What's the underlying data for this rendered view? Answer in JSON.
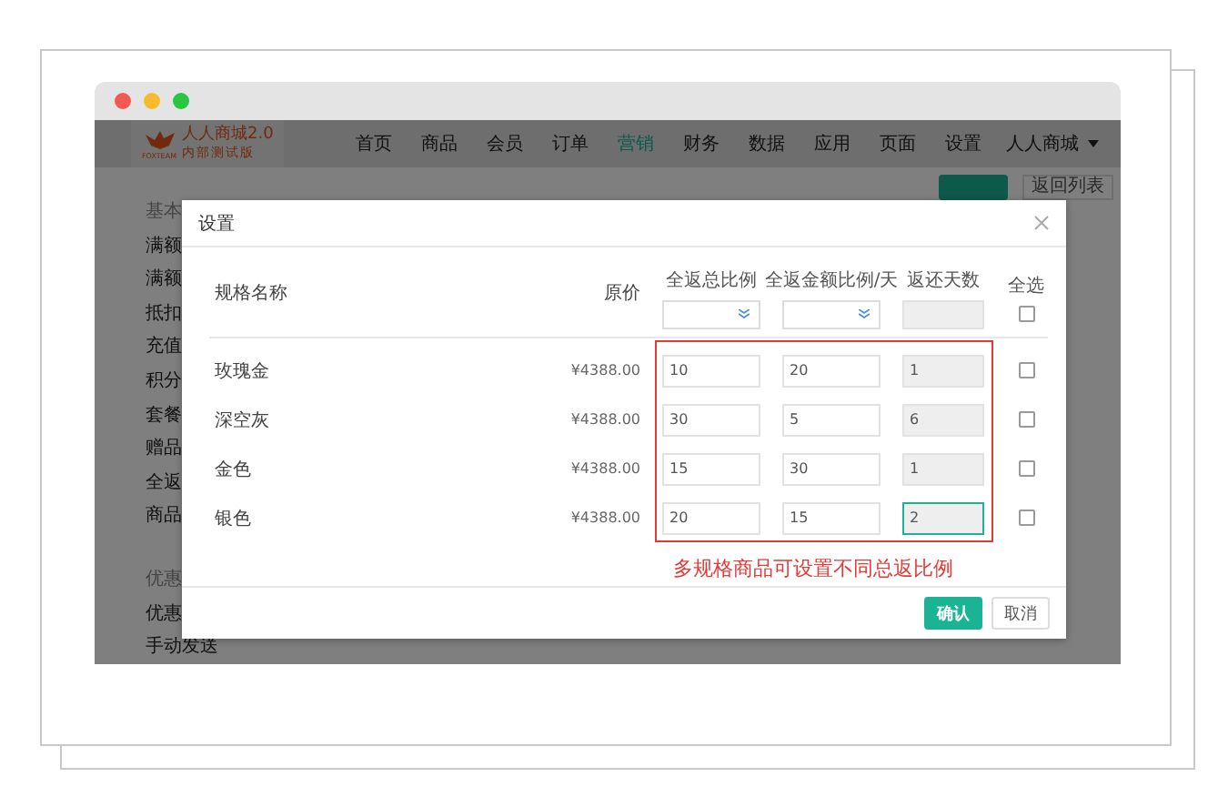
{
  "logo": {
    "title": "人人商城2.0",
    "subtitle": "内部测试版",
    "mark": "FOXTEAM"
  },
  "nav": [
    {
      "label": "首页",
      "selected": false
    },
    {
      "label": "商品",
      "selected": false
    },
    {
      "label": "会员",
      "selected": false
    },
    {
      "label": "订单",
      "selected": false
    },
    {
      "label": "营销",
      "selected": true
    },
    {
      "label": "财务",
      "selected": false
    },
    {
      "label": "数据",
      "selected": false
    },
    {
      "label": "应用",
      "selected": false
    },
    {
      "label": "页面",
      "selected": false
    },
    {
      "label": "设置",
      "selected": false
    }
  ],
  "account": "人人商城",
  "back_button": "返回列表",
  "sidebar": [
    {
      "kind": "header",
      "label": "基本"
    },
    {
      "kind": "item",
      "label": "满额"
    },
    {
      "kind": "item",
      "label": "满额"
    },
    {
      "kind": "item",
      "label": "抵扣"
    },
    {
      "kind": "item",
      "label": "充值"
    },
    {
      "kind": "item",
      "label": "积分"
    },
    {
      "kind": "item",
      "label": "套餐"
    },
    {
      "kind": "item",
      "label": "赠品"
    },
    {
      "kind": "item",
      "label": "全返"
    },
    {
      "kind": "item",
      "label": "商品"
    },
    {
      "kind": "header",
      "label": "优惠"
    },
    {
      "kind": "item",
      "label": "优惠"
    },
    {
      "kind": "item",
      "label": "手动发送"
    }
  ],
  "dialog": {
    "title": "设置",
    "columns": [
      "规格名称",
      "原价",
      "全返总比例",
      "全返金额比例/天",
      "返还天数",
      "全选"
    ],
    "select_all": {
      "checked": false
    },
    "rows": [
      {
        "name": "玫瑰金",
        "price": "¥4388.00",
        "ratio": "10",
        "daily_ratio": "20",
        "days": "1",
        "days_focused": false,
        "checked": false
      },
      {
        "name": "深空灰",
        "price": "¥4388.00",
        "ratio": "30",
        "daily_ratio": "5",
        "days": "6",
        "days_focused": false,
        "checked": false
      },
      {
        "name": "金色",
        "price": "¥4388.00",
        "ratio": "15",
        "daily_ratio": "30",
        "days": "1",
        "days_focused": false,
        "checked": false
      },
      {
        "name": "银色",
        "price": "¥4388.00",
        "ratio": "20",
        "daily_ratio": "15",
        "days": "2",
        "days_focused": true,
        "checked": false
      }
    ],
    "annotation": "多规格商品可设置不同总返比例",
    "buttons": [
      {
        "kind": "primary",
        "label": "确认"
      },
      {
        "kind": "default",
        "label": "取消"
      }
    ]
  }
}
